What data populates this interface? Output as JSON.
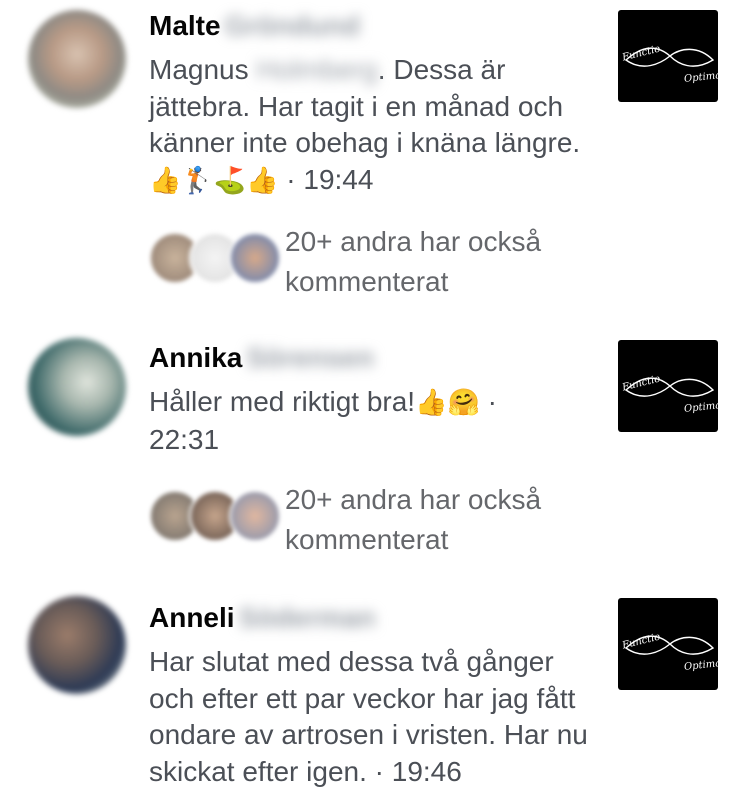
{
  "comments": [
    {
      "first_name": "Malte",
      "surname_blurred": "Gröndund",
      "text_part1": "Magnus",
      "blurred_mention": "Holmberg",
      "text_part2": ". Dessa är jättebra. Har tagit i en månad och känner inte obehag i knäna längre.",
      "emojis": [
        "👍",
        "🏌",
        "⛳",
        "👍"
      ],
      "timestamp": "· 19:44",
      "replies_text": "20+ andra har också kommenterat",
      "thumbnail_text1": "Functio",
      "thumbnail_text2": "Optima"
    },
    {
      "first_name": "Annika",
      "surname_blurred": "Sörensen",
      "text_part1": "Håller  med riktigt bra!",
      "emojis": [
        "👍",
        "🤗"
      ],
      "timestamp": "· 22:31",
      "replies_text": "20+ andra har också kommenterat",
      "thumbnail_text1": "Functio",
      "thumbnail_text2": "Optima"
    },
    {
      "first_name": "Anneli",
      "surname_blurred": "Söderman",
      "text_part1": "Har slutat med dessa två gånger och efter ett par veckor har jag fått ondare av artrosen i vristen. Har nu skickat efter igen.",
      "timestamp": "· 19:46",
      "thumbnail_text1": "Functio",
      "thumbnail_text2": "Optima"
    }
  ],
  "colors": {
    "name": "#050505",
    "body_text": "#4b4f56",
    "secondary": "#65676b",
    "thumbnail_bg": "#000000"
  }
}
